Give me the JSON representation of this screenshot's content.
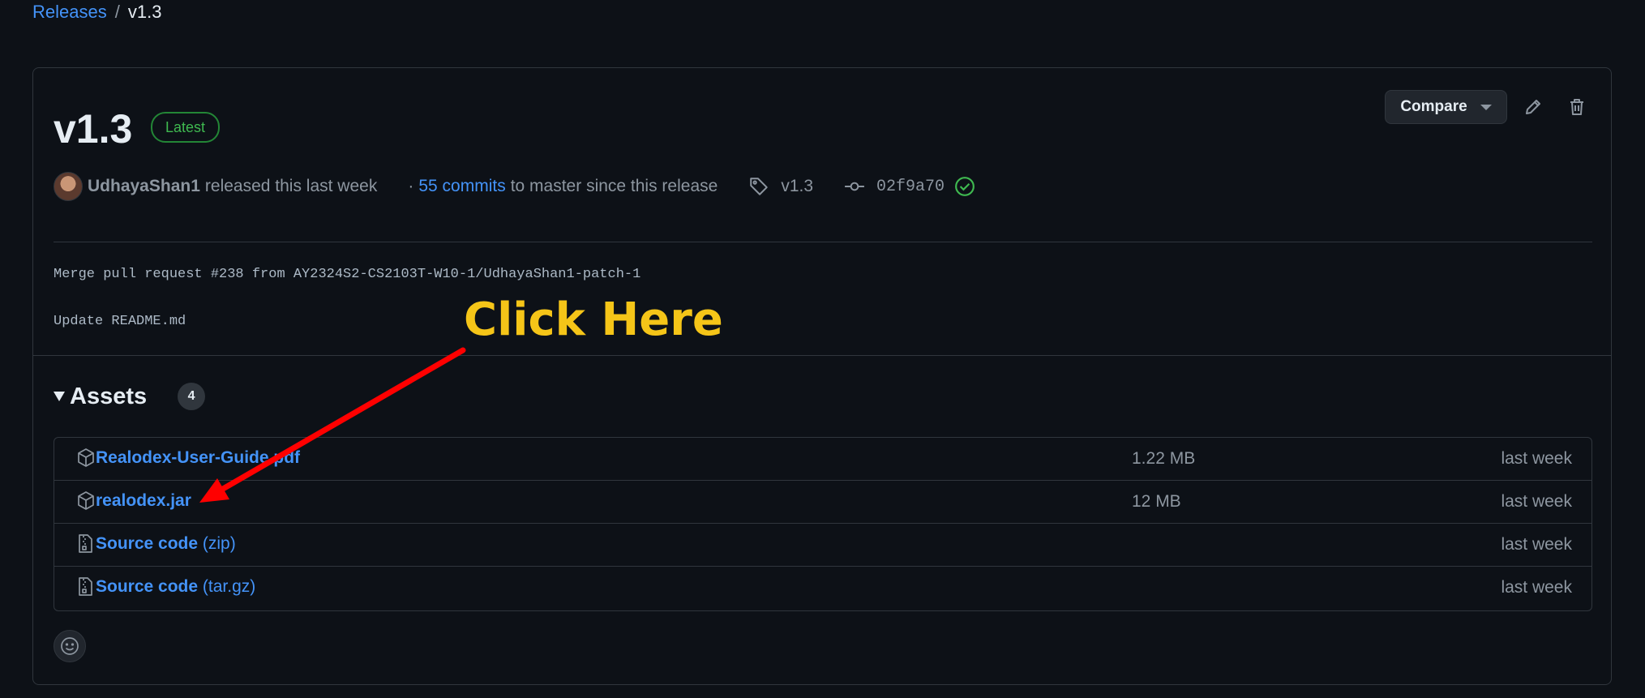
{
  "breadcrumb": {
    "parent": "Releases",
    "separator": "/",
    "current": "v1.3"
  },
  "release": {
    "title": "v1.3",
    "badge": "Latest",
    "author": "UdhayaShan1",
    "released_text": "released this last week",
    "commits_prefix": "·",
    "commits_link": "55 commits",
    "commits_suffix": "to master since this release",
    "tag": "v1.3",
    "commit_sha": "02f9a70"
  },
  "actions": {
    "compare_label": "Compare"
  },
  "body": {
    "line1": "Merge pull request #238 from AY2324S2-CS2103T-W10-1/UdhayaShan1-patch-1",
    "line2": "Update README.md"
  },
  "assets": {
    "title": "Assets",
    "count": "4",
    "rows": [
      {
        "name": "Realodex-User-Guide.pdf",
        "suffix": "",
        "size": "1.22 MB",
        "time": "last week",
        "icon": "package-icon"
      },
      {
        "name": "realodex.jar",
        "suffix": "",
        "size": "12 MB",
        "time": "last week",
        "icon": "package-icon"
      },
      {
        "name": "Source code",
        "suffix": "(zip)",
        "size": "",
        "time": "last week",
        "icon": "file-zip-icon"
      },
      {
        "name": "Source code",
        "suffix": "(tar.gz)",
        "size": "",
        "time": "last week",
        "icon": "file-zip-icon"
      }
    ]
  },
  "annotation": {
    "text": "Click Here",
    "color": "#f5c518",
    "arrow_color": "#ff0000"
  },
  "colors": {
    "background": "#0d1117",
    "link": "#4493f8",
    "muted": "#8d96a0",
    "success": "#3fb950",
    "border": "#30363d"
  }
}
